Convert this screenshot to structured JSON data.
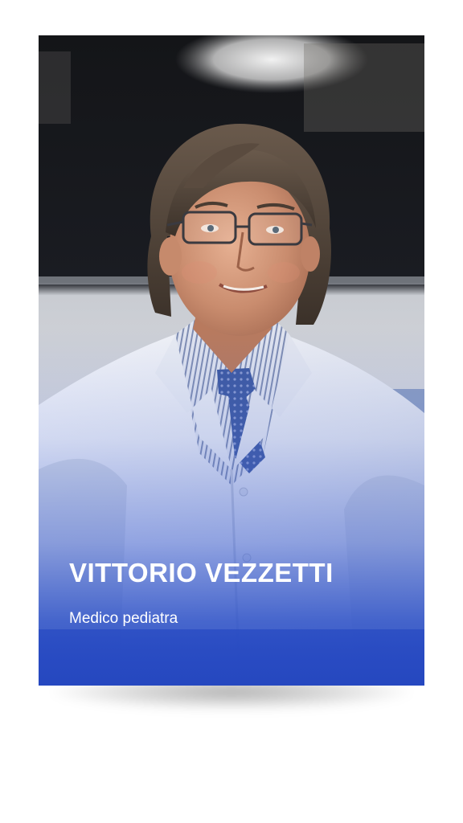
{
  "profile_card": {
    "name": "VITTORIO VEZZETTI",
    "role": "Medico pediatra"
  },
  "photo": {
    "subject": "doctor-portrait",
    "coat_color": "#eef0f6",
    "tie_color": "#3e5aa2"
  },
  "colors": {
    "overlay_blue": "#2f55c4",
    "background": "#ffffff",
    "text": "#ffffff"
  }
}
